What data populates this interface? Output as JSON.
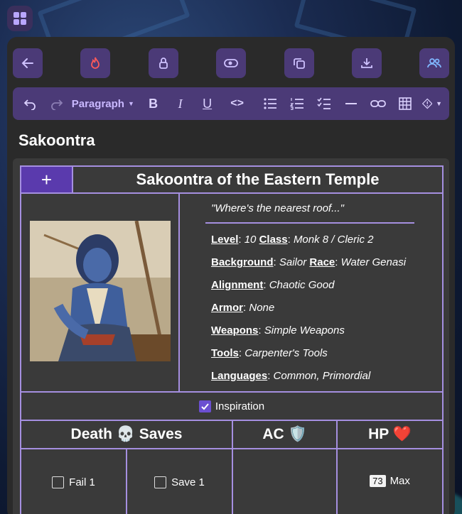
{
  "app": {
    "icon": "grid-apps-icon"
  },
  "toolbar": {
    "buttons": [
      "back-arrow-icon",
      "flame-icon",
      "lock-icon",
      "toggle-icon",
      "copy-icon",
      "download-icon",
      "users-icon"
    ]
  },
  "formatting": {
    "paragraph_label": "Paragraph",
    "undo": "undo-icon",
    "redo": "redo-icon",
    "bold": "B",
    "italic": "I",
    "underline": "U",
    "code": "<>",
    "items": [
      "bullet-list-icon",
      "numbered-list-icon",
      "checklist-icon",
      "horizontal-rule-icon",
      "link-icon",
      "table-icon",
      "alert-icon"
    ]
  },
  "document": {
    "title": "Sakoontra"
  },
  "sheet": {
    "add_label": "+",
    "name": "Sakoontra of the Eastern Temple",
    "quote": "\"Where's the nearest roof...\"",
    "level_label": "Level",
    "level_value": "10",
    "class_label": "Class",
    "class_value": "Monk 8 / Cleric 2",
    "background_label": "Background",
    "background_value": "Sailor",
    "race_label": "Race",
    "race_value": "Water Genasi",
    "alignment_label": "Alignment",
    "alignment_value": "Chaotic Good",
    "armor_label": "Armor",
    "armor_value": "None",
    "weapons_label": "Weapons",
    "weapons_value": "Simple Weapons",
    "tools_label": "Tools",
    "tools_value": "Carpenter's Tools",
    "languages_label": "Languages",
    "languages_value": "Common, Primordial",
    "inspiration_label": "Inspiration",
    "inspiration_checked": true,
    "death_saves_label": "Death 💀 Saves",
    "ac_label": "AC 🛡️",
    "hp_label": "HP ❤️",
    "fail_label": "Fail 1",
    "save_label": "Save 1",
    "hp_max_value": "73",
    "hp_max_label": "Max"
  },
  "colors": {
    "accent": "#a58fe0",
    "toolbar": "#4b3a77",
    "panel": "#2a2a2a",
    "sheet": "#3a3a3a",
    "add": "#5a3aad"
  }
}
